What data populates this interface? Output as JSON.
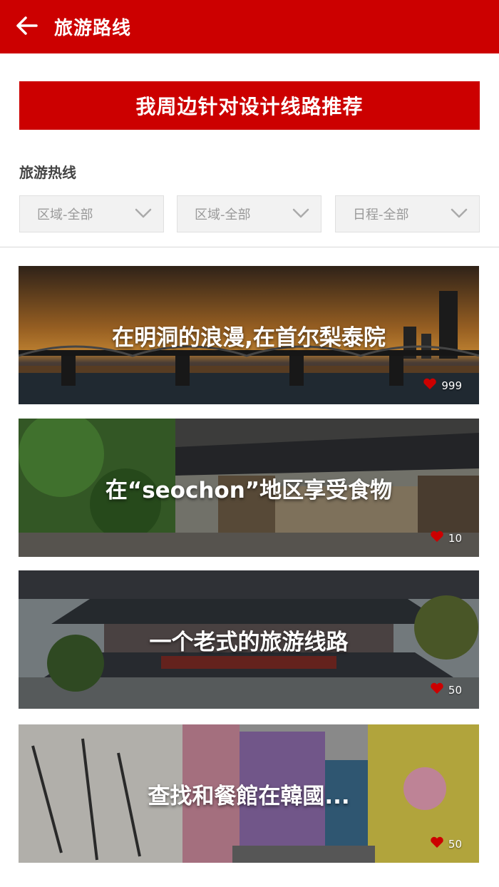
{
  "appbar": {
    "title": "旅游路线"
  },
  "recommend_button": {
    "label": "我周边针对设计线路推荐"
  },
  "section": {
    "title": "旅游热线"
  },
  "filters": [
    {
      "label": "区域-全部"
    },
    {
      "label": "区域-全部"
    },
    {
      "label": "日程-全部"
    }
  ],
  "routes": [
    {
      "title": "在明洞的浪漫,在首尔梨泰院",
      "likes": "999"
    },
    {
      "title": "在“seochon”地区享受食物",
      "likes": "10"
    },
    {
      "title": "一个老式的旅游线路",
      "likes": "50"
    },
    {
      "title": "查找和餐館在韓國...",
      "likes": "50"
    }
  ],
  "colors": {
    "brand": "#cc0000",
    "filter_bg": "#f2f2f2",
    "heart": "#cc0000"
  }
}
